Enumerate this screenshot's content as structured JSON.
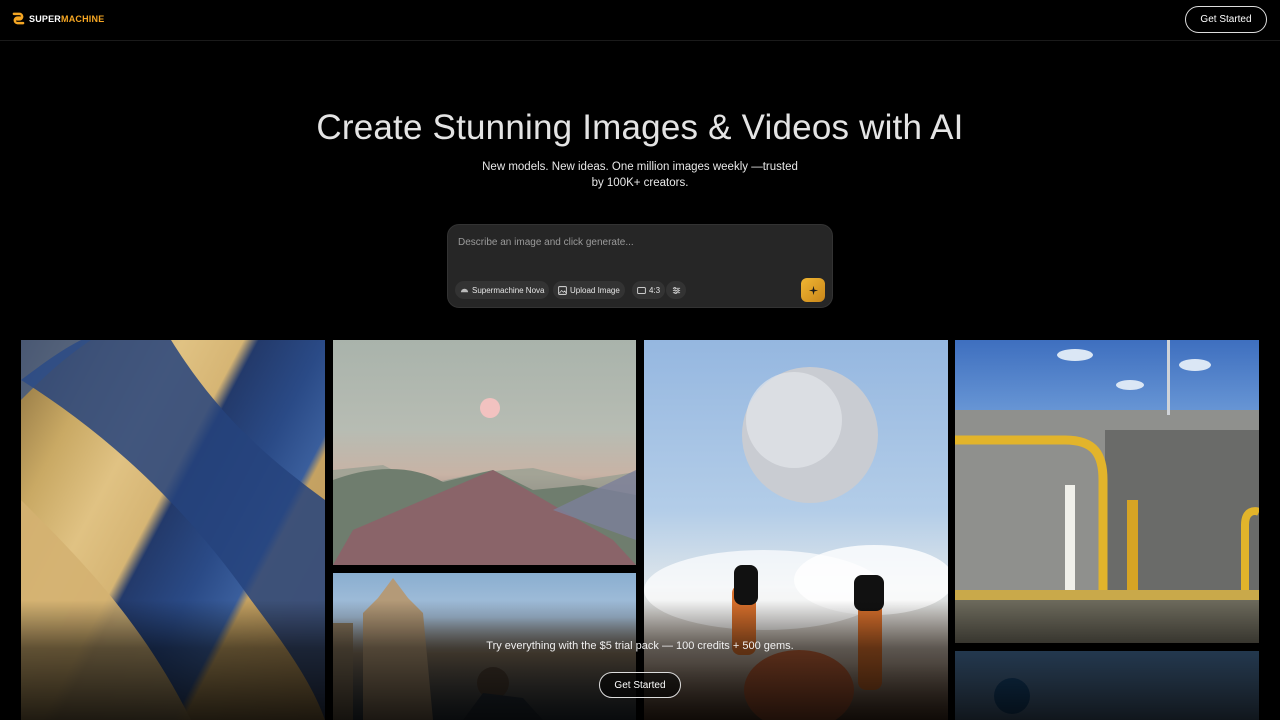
{
  "brand": {
    "name_part1": "SUPER",
    "name_part2": "MACHINE",
    "accent": "#f5a623"
  },
  "header": {
    "cta_label": "Get Started"
  },
  "hero": {
    "title": "Create Stunning Images & Videos with AI",
    "subtitle": "New models. New ideas. One million images weekly —trusted by 100K+ creators."
  },
  "prompt": {
    "placeholder": "Describe an image and click generate...",
    "model_label": "Supermachine Nova",
    "upload_label": "Upload Image",
    "ratio_label": "4:3",
    "icons": [
      "palette-icon",
      "image-icon",
      "aspect-ratio-icon",
      "sliders-icon",
      "sparkle-icon"
    ]
  },
  "gallery": {
    "items": [
      "desert-dunes-image",
      "pastel-mountains-moon-image",
      "gothic-building-image",
      "disco-ball-astronaut-image",
      "yellow-poles-wall-image",
      "blue-sky-image"
    ]
  },
  "promo": {
    "text": "Try everything with the $5 trial pack — 100 credits + 500 gems.",
    "cta_label": "Get Started"
  }
}
